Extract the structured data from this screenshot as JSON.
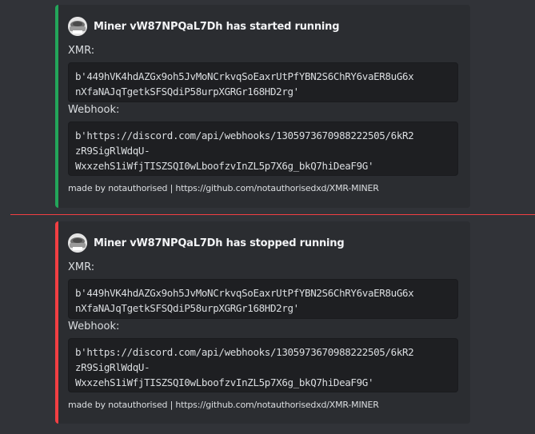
{
  "colors": {
    "started_bar": "#23a55a",
    "stopped_bar": "#f23f43",
    "divider": "#f23f42"
  },
  "embeds": [
    {
      "author_icon": "miner-avatar-icon",
      "title": "Miner vW87NPQaL7Dh has started running",
      "xmr_label": "XMR:",
      "xmr_lines": [
        "b'449hVK4hdAZGx9oh5JvMoNCrkvqSoEaxrUtPfYBN2S6ChRY6vaER8uG6x",
        "nXfaNAJqTgetkSFSQdiP58urpXGRGr168HD2rg'"
      ],
      "webhook_label": "Webhook:",
      "webhook_lines": [
        "b'https://discord.com/api/webhooks/1305973670988222505/6kR2",
        "zR9SigRlWdqU-",
        "WxxzehS1iWfjTISZSQI0wLboofzvInZL5p7X6g_bkQ7hiDeaF9G'"
      ],
      "footer": "made by notauthorised | https://github.com/notauthorisedxd/XMR-MINER"
    },
    {
      "author_icon": "miner-avatar-icon",
      "title": "Miner vW87NPQaL7Dh has stopped running",
      "xmr_label": "XMR:",
      "xmr_lines": [
        "b'449hVK4hdAZGx9oh5JvMoNCrkvqSoEaxrUtPfYBN2S6ChRY6vaER8uG6x",
        "nXfaNAJqTgetkSFSQdiP58urpXGRGr168HD2rg'"
      ],
      "webhook_label": "Webhook:",
      "webhook_lines": [
        "b'https://discord.com/api/webhooks/1305973670988222505/6kR2",
        "zR9SigRlWdqU-",
        "WxxzehS1iWfjTISZSQI0wLboofzvInZL5p7X6g_bkQ7hiDeaF9G'"
      ],
      "footer": "made by notauthorised | https://github.com/notauthorisedxd/XMR-MINER"
    }
  ]
}
